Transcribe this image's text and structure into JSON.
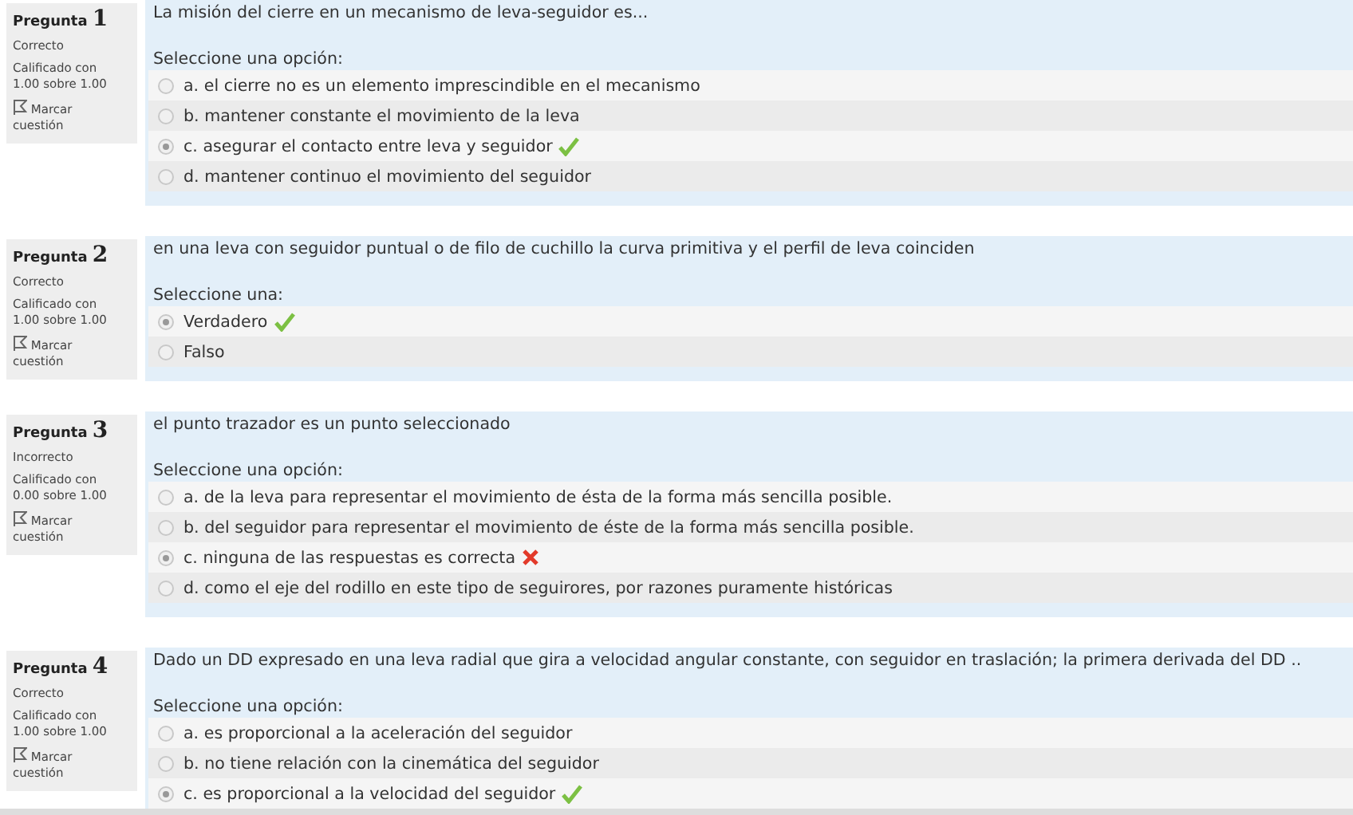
{
  "questions": [
    {
      "label": "Pregunta",
      "number": "1",
      "status": "Correcto",
      "grade": "Calificado con 1.00 sobre 1.00",
      "flag": "Marcar cuestión",
      "text": "La misión del cierre en un mecanismo de leva-seguidor es...",
      "prompt": "Seleccione una opción:",
      "options": [
        {
          "text": "a. el cierre no es un elemento imprescindible en el mecanismo",
          "selected": false,
          "kind": "plain"
        },
        {
          "text": "b. mantener constante el movimiento de la leva",
          "selected": false,
          "kind": "plain"
        },
        {
          "text": "c. asegurar el contacto entre leva y seguidor",
          "selected": true,
          "kind": "correct"
        },
        {
          "text": "d. mantener continuo el movimiento del seguidor",
          "selected": false,
          "kind": "plain"
        }
      ]
    },
    {
      "label": "Pregunta",
      "number": "2",
      "status": "Correcto",
      "grade": "Calificado con 1.00 sobre 1.00",
      "flag": "Marcar cuestión",
      "text": "en una leva con seguidor puntual o de filo de cuchillo la curva primitiva y el perfil de leva coinciden",
      "prompt": "Seleccione una:",
      "options": [
        {
          "text": "Verdadero",
          "selected": true,
          "kind": "correct"
        },
        {
          "text": "Falso",
          "selected": false,
          "kind": "plain"
        }
      ]
    },
    {
      "label": "Pregunta",
      "number": "3",
      "status": "Incorrecto",
      "grade": "Calificado con 0.00 sobre 1.00",
      "flag": "Marcar cuestión",
      "text": "el punto trazador es un punto seleccionado",
      "prompt": "Seleccione una opción:",
      "options": [
        {
          "text": "a. de la leva para representar el movimiento de ésta de la forma más sencilla posible.",
          "selected": false,
          "kind": "plain"
        },
        {
          "text": "b. del seguidor para representar el movimiento de éste de la forma más sencilla posible.",
          "selected": false,
          "kind": "plain"
        },
        {
          "text": "c. ninguna de las respuestas es correcta",
          "selected": true,
          "kind": "incorrect"
        },
        {
          "text": "d. como el eje del rodillo en este tipo de seguirores, por razones puramente históricas",
          "selected": false,
          "kind": "plain"
        }
      ]
    },
    {
      "label": "Pregunta",
      "number": "4",
      "status": "Correcto",
      "grade": "Calificado con 1.00 sobre 1.00",
      "flag": "Marcar cuestión",
      "text": "Dado un DD expresado en una leva radial que gira a velocidad angular constante, con seguidor en traslación; la primera derivada del DD ..",
      "prompt": "Seleccione una opción:",
      "options": [
        {
          "text": "a. es proporcional a la aceleración del seguidor",
          "selected": false,
          "kind": "plain"
        },
        {
          "text": "b. no tiene relación con la cinemática del seguidor",
          "selected": false,
          "kind": "plain"
        },
        {
          "text": "c. es proporcional a la velocidad del seguidor",
          "selected": true,
          "kind": "correct"
        }
      ]
    }
  ]
}
